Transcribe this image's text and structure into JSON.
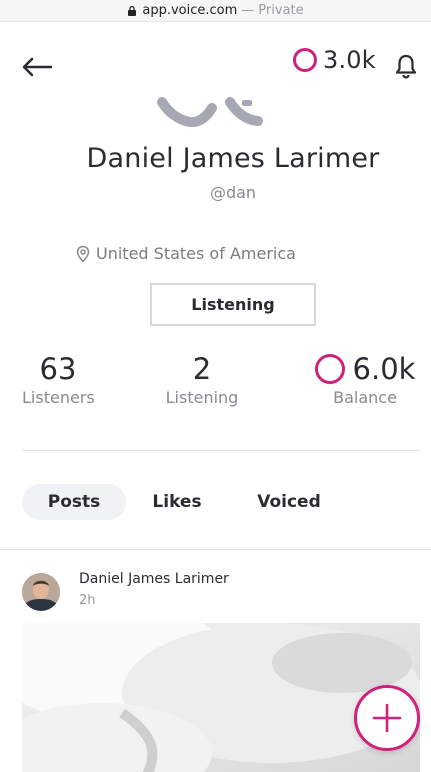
{
  "browser": {
    "url": "app.voice.com",
    "mode_sep": "—",
    "mode": "Private"
  },
  "header": {
    "balance": "3.0k",
    "icons": [
      "back-arrow-icon",
      "voice-token-icon",
      "bell-icon"
    ]
  },
  "profile": {
    "name": "Daniel James Larimer",
    "handle": "@dan",
    "location": "United States of America",
    "listening_button": "Listening"
  },
  "stats": {
    "listeners_value": "63",
    "listeners_label": "Listeners",
    "listening_value": "2",
    "listening_label": "Listening",
    "balance_value": "6.0k",
    "balance_label": "Balance"
  },
  "tabs": {
    "posts": "Posts",
    "likes": "Likes",
    "voiced": "Voiced",
    "active": "Posts"
  },
  "post": {
    "author": "Daniel James Larimer",
    "time": "2h"
  },
  "colors": {
    "accent": "#d0217c",
    "text": "#2b2b33",
    "muted": "#8a8a92"
  }
}
